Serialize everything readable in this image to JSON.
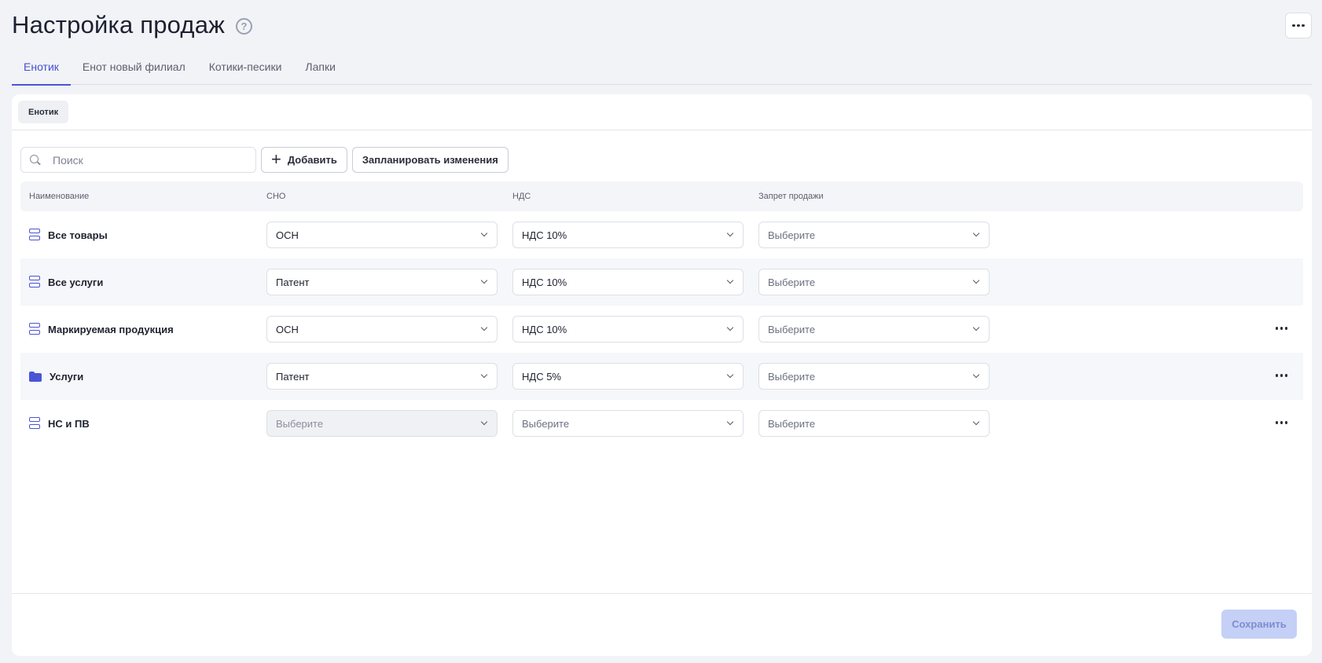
{
  "header": {
    "title": "Настройка продаж",
    "help_icon": "question-circle-icon",
    "more_icon": "ellipsis-icon"
  },
  "tabs": [
    {
      "label": "Енотик",
      "active": true
    },
    {
      "label": "Енот новый филиал",
      "active": false
    },
    {
      "label": "Котики-песики",
      "active": false
    },
    {
      "label": "Лапки",
      "active": false
    }
  ],
  "chip": {
    "label": "Енотик"
  },
  "toolbar": {
    "search_placeholder": "Поиск",
    "add_label": "Добавить",
    "schedule_label": "Запланировать изменения"
  },
  "table": {
    "headers": {
      "name": "Наименование",
      "sno": "СНО",
      "nds": "НДС",
      "ban": "Запрет продажи"
    },
    "rows": [
      {
        "name": "Все товары",
        "icon": "stack-icon",
        "sno": "ОСН",
        "nds": "НДС 10%",
        "ban": "Выберите",
        "more": false
      },
      {
        "name": "Все услуги",
        "icon": "stack-icon",
        "sno": "Патент",
        "nds": "НДС 10%",
        "ban": "Выберите",
        "more": false
      },
      {
        "name": "Маркируемая продукция",
        "icon": "stack-icon",
        "sno": "ОСН",
        "nds": "НДС 10%",
        "ban": "Выберите",
        "more": true
      },
      {
        "name": "Услуги",
        "icon": "folder-icon",
        "sno": "Патент",
        "nds": "НДС 5%",
        "ban": "Выберите",
        "more": true
      },
      {
        "name": "НС и ПВ",
        "icon": "stack-icon",
        "sno": "Выберите",
        "nds": "Выберите",
        "ban": "Выберите",
        "more": true,
        "sno_disabled": true
      }
    ]
  },
  "footer": {
    "save_label": "Сохранить"
  },
  "colors": {
    "accent": "#4a55d6",
    "background": "#f2f3f7",
    "save_disabled_bg": "#c5d0f7"
  }
}
